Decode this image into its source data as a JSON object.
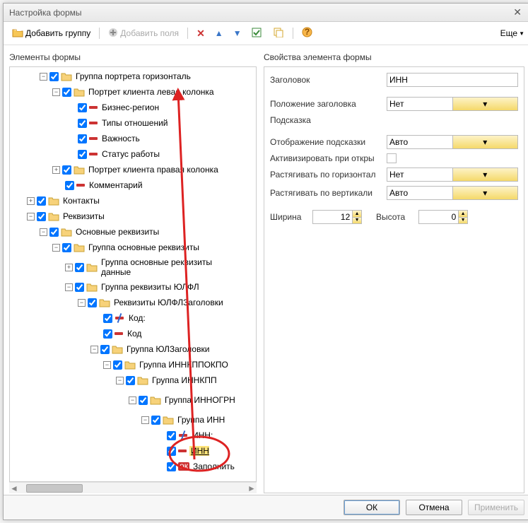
{
  "window": {
    "title": "Настройка формы"
  },
  "toolbar": {
    "add_group": "Добавить группу",
    "add_fields": "Добавить поля",
    "more": "Еще"
  },
  "headers": {
    "elements": "Элементы формы",
    "properties": "Свойства элемента формы"
  },
  "tree": {
    "portret_h": "Группа портрета горизонталь",
    "portret_left": "Портрет клиента левая колонка",
    "biz_region": "Бизнес-регион",
    "rel_types": "Типы отношений",
    "importance": "Важность",
    "status": "Статус работы",
    "portret_right": "Портрет клиента правая колонка",
    "comment": "Комментарий",
    "contacts": "Контакты",
    "rekv": "Реквизиты",
    "main_rekv": "Основные реквизиты",
    "grp_main_rekv": "Группа основные реквизиты",
    "grp_main_rekv_data": "Группа основные реквизиты данные",
    "grp_rekv_ulfl": "Группа реквизиты ЮЛФЛ",
    "rekv_ulfl_hdr": "Реквизиты ЮЛФЛЗаголовки",
    "kod_lbl": "Код:",
    "kod": "Код",
    "grp_ul_hdr": "Группа ЮЛЗаголовки",
    "grp_innkppokpo": "Группа ИННКППОКПО",
    "grp_innkpp": "Группа ИННКПП",
    "grp_innogrn": "Группа ИННОГРН",
    "grp_inn": "Группа ИНН",
    "inn_lbl": "ИНН:",
    "inn": "ИНН",
    "fill": "Заполнить"
  },
  "props": {
    "title_lbl": "Заголовок",
    "title_val": "ИНН",
    "title_pos_lbl": "Положение заголовка",
    "title_pos_val": "Нет",
    "hint_lbl": "Подсказка",
    "hint_val": "",
    "hint_disp_lbl": "Отображение подсказки",
    "hint_disp_val": "Авто",
    "act_open_lbl": "Активизировать при откры",
    "stretch_h_lbl": "Растягивать по горизонтал",
    "stretch_h_val": "Нет",
    "stretch_v_lbl": "Растягивать по вертикали",
    "stretch_v_val": "Авто",
    "width_lbl": "Ширина",
    "width_val": "12",
    "height_lbl": "Высота",
    "height_val": "0"
  },
  "footer": {
    "ok": "ОК",
    "cancel": "Отмена",
    "apply": "Применить"
  }
}
